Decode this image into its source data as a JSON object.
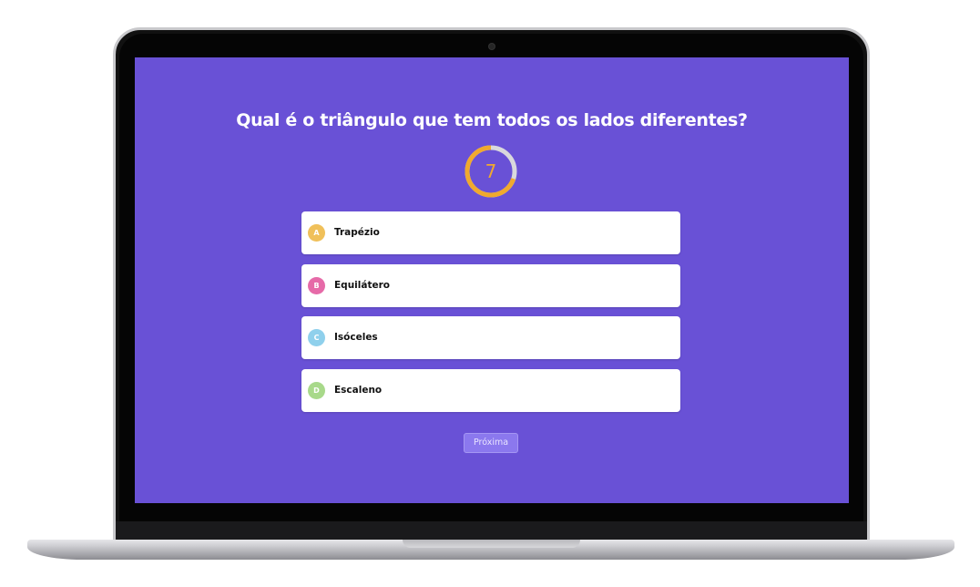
{
  "quiz": {
    "question": "Qual é o triângulo que tem todos os lados diferentes?",
    "timer": {
      "value": "7",
      "remaining_fraction": 0.7,
      "color": "#f0a92e",
      "track_color": "#d9d9dd"
    },
    "options": [
      {
        "letter": "A",
        "label": "Trapézio",
        "color": "#f0c05a"
      },
      {
        "letter": "B",
        "label": "Equilátero",
        "color": "#e66aa8"
      },
      {
        "letter": "C",
        "label": "Isóceles",
        "color": "#8fd0ec"
      },
      {
        "letter": "D",
        "label": "Escaleno",
        "color": "#a8d98a"
      }
    ],
    "next_label": "Próxima"
  },
  "colors": {
    "background": "#6951d6",
    "next_button": "#8b78ee"
  }
}
